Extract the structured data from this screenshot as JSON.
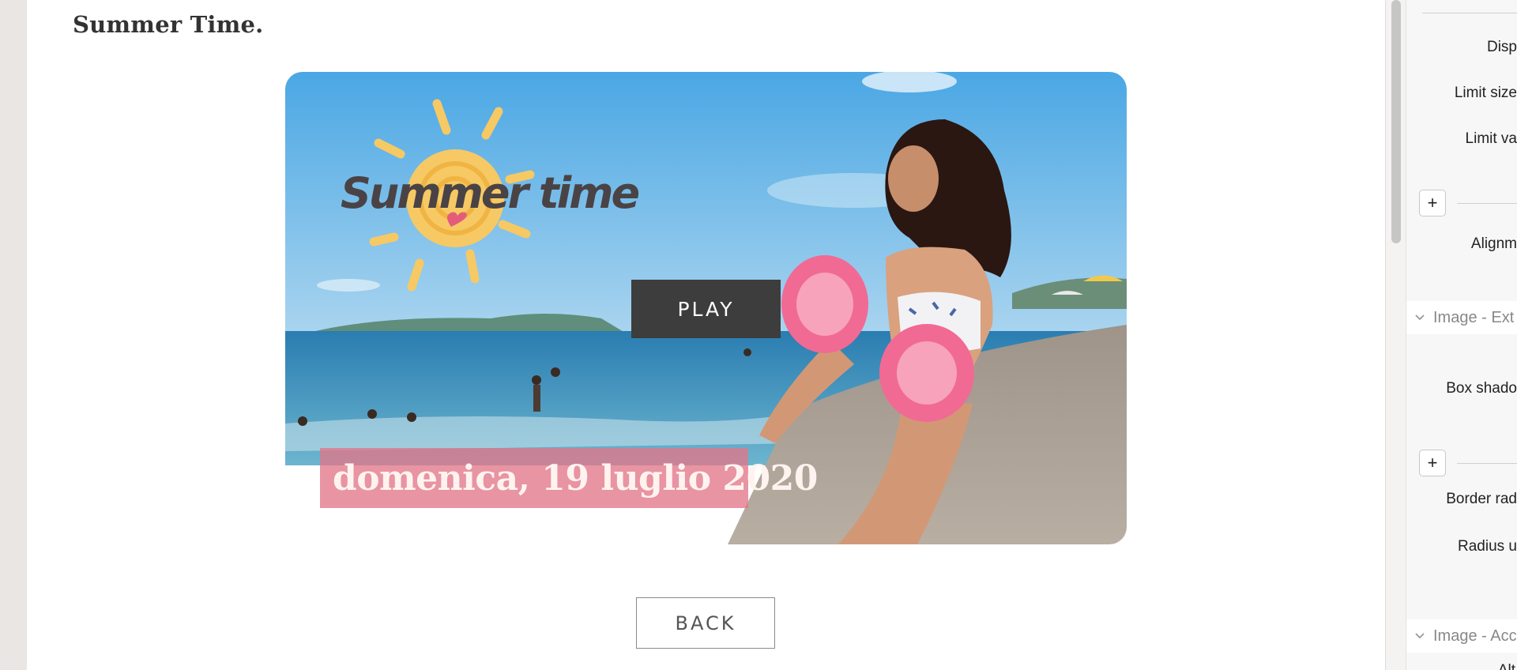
{
  "page": {
    "title": "Summer Time."
  },
  "video": {
    "logo_text": "Summer time",
    "play_label": "PLAY",
    "date_text": "domenica, 19 luglio 2020"
  },
  "back_label": "BACK",
  "panel": {
    "labels": {
      "display": "Disp",
      "limit_size": "Limit size",
      "limit_value": "Limit va",
      "alignment": "Alignm",
      "box_shadow": "Box shado",
      "border_radius": "Border rad",
      "radius_unit": "Radius u",
      "alt": "Alt"
    },
    "plus_label": "+",
    "sections": {
      "image_ext": "Image - Ext",
      "image_acc": "Image - Acc"
    }
  },
  "colors": {
    "play_bg": "#3d3d3d",
    "banner_bg": "#e27688",
    "sky": "#5fb3e6",
    "sea": "#2e7fb0",
    "sand": "#a89d8f"
  }
}
